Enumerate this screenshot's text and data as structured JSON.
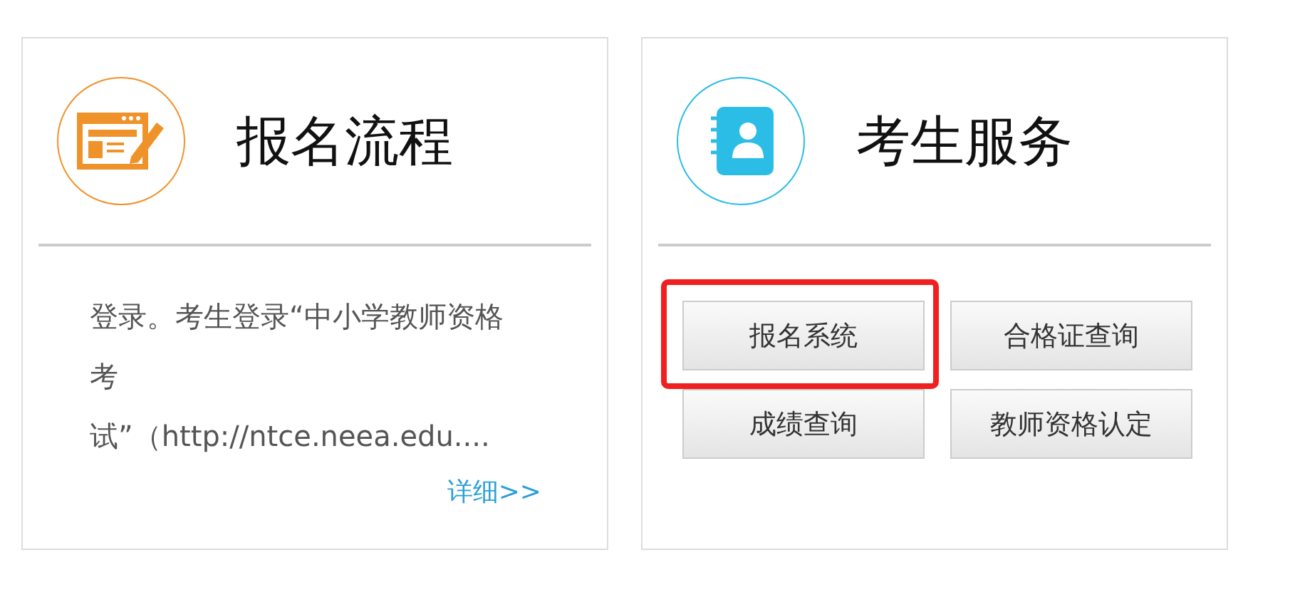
{
  "cards": [
    {
      "kind": "text",
      "title": "报名流程",
      "color": "#f0922a",
      "body": "登录。考生登录“中小学教师资格考试”（http://ntce.neea.edu....",
      "link": "详细>>"
    },
    {
      "kind": "buttons",
      "title": "考生服务",
      "color": "#2bbde6",
      "buttons": [
        {
          "label": "报名系统",
          "highlighted": true
        },
        {
          "label": "合格证查询",
          "highlighted": false
        },
        {
          "label": "成绩查询",
          "highlighted": false
        },
        {
          "label": "教师资格认定",
          "highlighted": false
        }
      ]
    }
  ]
}
